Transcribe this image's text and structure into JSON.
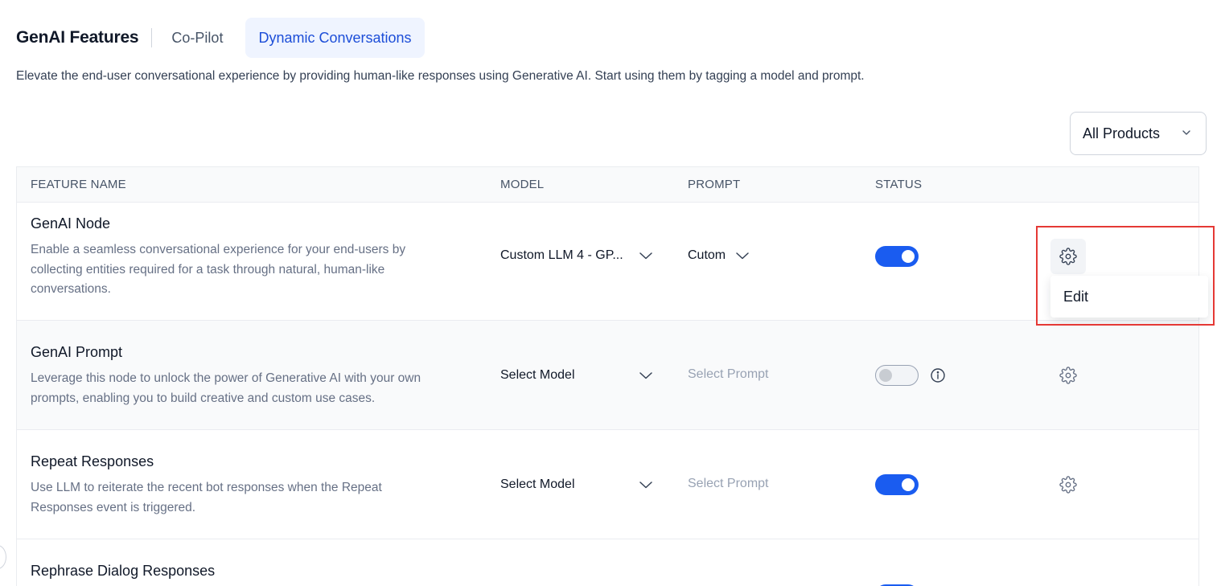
{
  "header": {
    "title": "GenAI Features",
    "tabs": [
      {
        "label": "Co-Pilot",
        "active": false
      },
      {
        "label": "Dynamic Conversations",
        "active": true
      }
    ]
  },
  "description": "Elevate the end-user conversational experience by providing human-like responses using Generative AI. Start using them by tagging a model and prompt.",
  "filter": {
    "selected": "All Products",
    "icon": "chevron-down-icon"
  },
  "table": {
    "columns": {
      "feature": "FEATURE NAME",
      "model": "MODEL",
      "prompt": "PROMPT",
      "status": "STATUS"
    },
    "rows": [
      {
        "name": "GenAI Node",
        "description_lines": [
          "Enable a seamless conversational experience for your end-users by",
          "collecting entities required for a task through natural, human-like",
          "conversations."
        ],
        "model": "Custom LLM 4 - GP...",
        "prompt": "Cutom",
        "status_on": true
      },
      {
        "name": "GenAI Prompt",
        "description_lines": [
          "Leverage this node to unlock the power of Generative AI with your own",
          "prompts, enabling you to build creative and custom use cases."
        ],
        "model": "Select Model",
        "prompt": "Select Prompt",
        "status_on": false
      },
      {
        "name": "Repeat Responses",
        "description_lines": [
          "Use LLM to reiterate the recent bot responses when the Repeat",
          "Responses event is triggered."
        ],
        "model": "Select Model",
        "prompt": "Select Prompt",
        "status_on": true
      },
      {
        "name": "Rephrase Dialog Responses",
        "description_lines": [],
        "model": "",
        "prompt": "",
        "status_on": true
      }
    ]
  },
  "context_menu": {
    "items": [
      "Edit"
    ]
  },
  "colors": {
    "accent": "#1a5cf0",
    "active_tab_bg": "#eff4ff",
    "highlight": "#e53935"
  }
}
